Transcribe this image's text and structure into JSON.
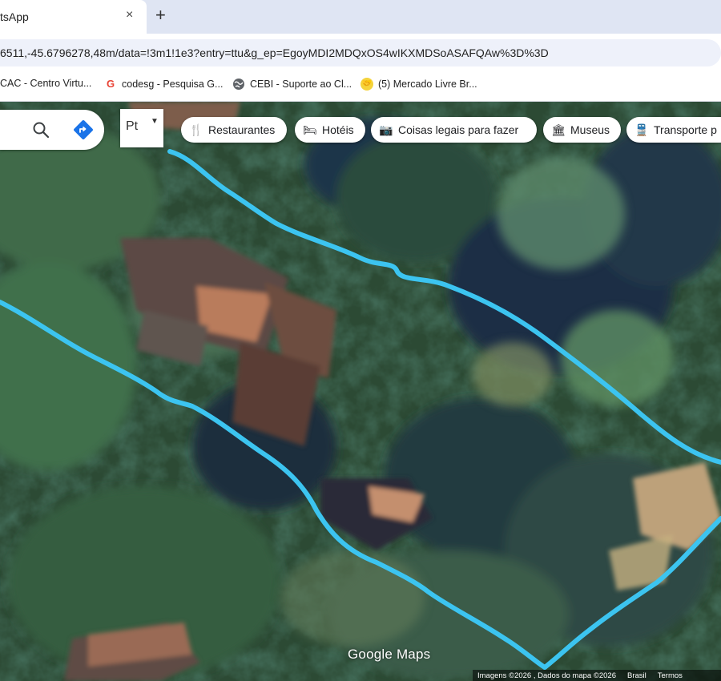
{
  "browser": {
    "tab_title": "tsApp",
    "tab_close": "×",
    "new_tab": "+",
    "url": "6511,-45.6796278,48m/data=!3m1!1e3?entry=ttu&g_ep=EgoyMDI2MDQxOS4wIKXMDSoASAFQAw%3D%3D"
  },
  "bookmarks": [
    {
      "label": "CAC - Centro Virtu...",
      "icon": "none"
    },
    {
      "label": "codesg - Pesquisa G...",
      "icon": "google-icon"
    },
    {
      "label": "CEBI - Suporte ao Cl...",
      "icon": "globe-icon"
    },
    {
      "label": "(5) Mercado Livre Br...",
      "icon": "mercadolivre-icon"
    }
  ],
  "map": {
    "layer_button_label": "Pt",
    "chips": [
      {
        "label": "Restaurantes",
        "icon": "fork-knife-icon"
      },
      {
        "label": "Hotéis",
        "icon": "bed-icon"
      },
      {
        "label": "Coisas legais para fazer",
        "icon": "camera-icon"
      },
      {
        "label": "Museus",
        "icon": "museum-icon"
      },
      {
        "label": "Transporte p",
        "icon": "train-icon"
      }
    ],
    "watermark": "Google Maps",
    "attribution": {
      "imagery": "Imagens ©2026 , Dados do mapa ©2026",
      "country": "Brasil",
      "terms": "Termos"
    },
    "boundary_color": "#3cc4f0"
  }
}
